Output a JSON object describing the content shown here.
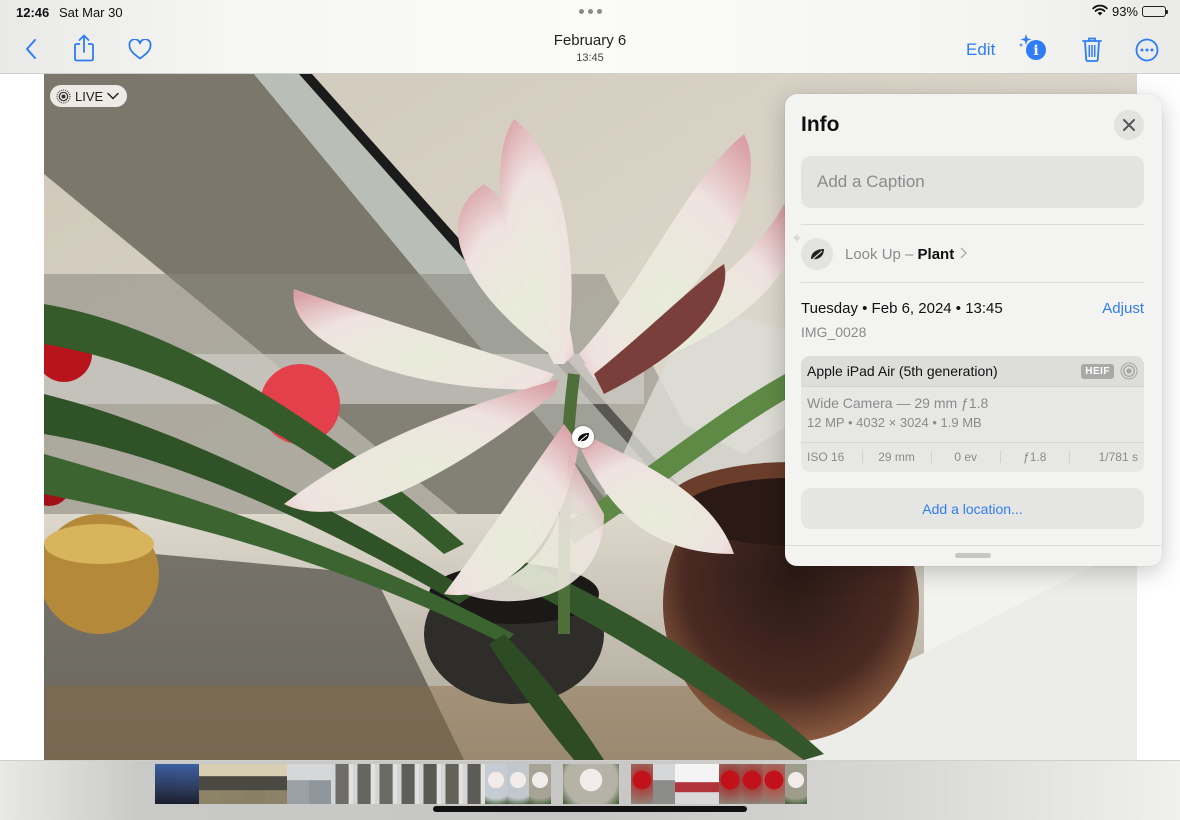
{
  "status_bar": {
    "time": "12:46",
    "date": "Sat Mar 30",
    "battery_percent": "93%",
    "battery_level": 0.93,
    "wifi_icon": "wifi-icon"
  },
  "nav": {
    "title": "February 6",
    "subtitle": "13:45",
    "edit_label": "Edit",
    "icons": {
      "back": "chevron-left-icon",
      "share": "share-icon",
      "favorite": "heart-icon",
      "visual_info": "info-sparkle-icon",
      "delete": "trash-icon",
      "more": "ellipsis-circle-icon"
    }
  },
  "photo": {
    "live_label": "LIVE",
    "lookup_badge_icon": "leaf-icon"
  },
  "info_panel": {
    "title": "Info",
    "caption_placeholder": "Add a Caption",
    "caption_value": "",
    "lookup": {
      "prefix": "Look Up – ",
      "subject": "Plant"
    },
    "date_line": "Tuesday • Feb 6, 2024 • 13:45",
    "adjust_label": "Adjust",
    "filename": "IMG_0028",
    "camera": {
      "model": "Apple iPad Air (5th generation)",
      "format_badge": "HEIF",
      "lens": "Wide Camera — 29 mm ƒ1.8",
      "specs": "12 MP  •  4032 × 3024  •  1.9 MB",
      "exif": [
        "ISO 16",
        "29 mm",
        "0 ev",
        "ƒ1.8",
        "1/781 s"
      ]
    },
    "location_label": "Add a location..."
  },
  "filmstrip": {
    "thumbnails": [
      {
        "kind": "screenshot",
        "color": "#2b3a5a"
      },
      {
        "kind": "screenshot",
        "color": "#2e3d5e"
      },
      {
        "kind": "keyboard",
        "color": "#8d8468"
      },
      {
        "kind": "keyboard",
        "color": "#8a8166"
      },
      {
        "kind": "keyboard",
        "color": "#888064"
      },
      {
        "kind": "keyboard",
        "color": "#8b8267"
      },
      {
        "kind": "person",
        "color": "#9aa0a6"
      },
      {
        "kind": "person",
        "color": "#8f969c"
      },
      {
        "kind": "window",
        "color": "#6d6c66"
      },
      {
        "kind": "window",
        "color": "#66655f"
      },
      {
        "kind": "window",
        "color": "#6a6963"
      },
      {
        "kind": "window",
        "color": "#5f5e58"
      },
      {
        "kind": "window",
        "color": "#5a5954"
      },
      {
        "kind": "window",
        "color": "#616059"
      },
      {
        "kind": "window",
        "color": "#5c5b55"
      },
      {
        "kind": "flower-snow",
        "color": "#c7ccd2"
      },
      {
        "kind": "flower-snow",
        "color": "#c2c7cd"
      },
      {
        "kind": "flower",
        "color": "#a7a496"
      },
      {
        "kind": "flower-selected",
        "color": "#b5b3a6",
        "selected": true
      },
      {
        "kind": "red-flower",
        "color": "#a8443f"
      },
      {
        "kind": "person",
        "color": "#8c8c8a"
      },
      {
        "kind": "screenshot-light",
        "color": "#e9e9e9"
      },
      {
        "kind": "screenshot-light",
        "color": "#e6e6e6"
      },
      {
        "kind": "red-flower",
        "color": "#9f3c39"
      },
      {
        "kind": "red-flower",
        "color": "#a4413e"
      },
      {
        "kind": "red-flower",
        "color": "#b0544c"
      },
      {
        "kind": "flower",
        "color": "#9e9c8c"
      }
    ]
  }
}
